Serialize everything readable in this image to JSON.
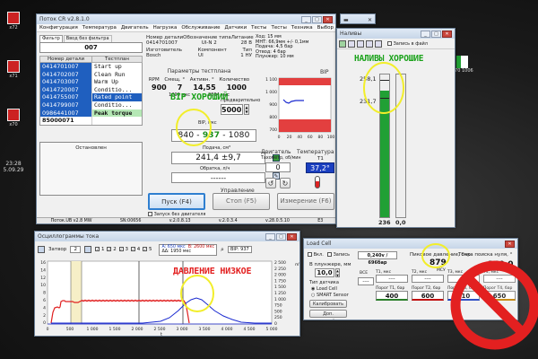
{
  "desktop": {
    "icons": [
      {
        "label": "x72"
      },
      {
        "label": "x71"
      },
      {
        "label": "x70"
      }
    ],
    "clock": [
      "23:28",
      "5.09.29"
    ],
    "right_file": "1.70 1006",
    "accent": "#21a035"
  },
  "main_window": {
    "title": "Поток CR v2.8.1.0",
    "menu": [
      "Конфигурация",
      "Температура",
      "Двигатель",
      "Нагрузка",
      "Обслуживание",
      "Датчики",
      "Тесты",
      "Тесты",
      "Техника",
      "Выбор режима",
      "Тест",
      "Язык",
      "Справка"
    ],
    "tabs": [
      "Фильтр",
      "Ввод без фильтра"
    ],
    "filter_value": "007",
    "list_headers": [
      "Номер детали",
      "Тестплан"
    ],
    "parts": [
      {
        "num": "0414701007",
        "plan": "Start up",
        "hl": true
      },
      {
        "num": "0414702007",
        "plan": "Clean Run",
        "hl": true
      },
      {
        "num": "0414703007",
        "plan": "Warm Up",
        "hl": true
      },
      {
        "num": "0414720007",
        "plan": "Conditio...",
        "hl": true
      },
      {
        "num": "0414755007",
        "plan": "Rated point",
        "hl": true,
        "sel": true
      },
      {
        "num": "0414799007",
        "plan": "Conditio...",
        "hl": true
      },
      {
        "num": "0986441007",
        "plan": "Peak torque",
        "hl": true,
        "peak": true
      },
      {
        "num": "85000071",
        "plan": "",
        "hl": false
      }
    ],
    "stopped_label": "Остановлен",
    "info_headers": [
      "Номер детали",
      "Обозначение типа",
      "Литание"
    ],
    "info_values": [
      "0414701007",
      "UI-N 2",
      "28 В"
    ],
    "info2_headers": [
      "Изготовитель",
      "Компонент",
      "Тип"
    ],
    "info2_values": [
      "Bosch",
      "UI",
      "1 НУ"
    ],
    "info_right": [
      "Ход: 15 мм",
      "МНТ: 66,9мм +/- 0,1мм",
      "Подача: 4,5 бар",
      "Отвод: 4 бар",
      "Плунжер: 10 мм"
    ],
    "params_title": "Параметры тестплана",
    "param_headers": [
      "RPM",
      "Смещ. °",
      "Активн. °",
      "Количество"
    ],
    "param_values": [
      "900",
      "7",
      "14,55",
      "1000"
    ],
    "param_sub": [
      "1296 мкс",
      "2684 мкс"
    ],
    "preset_label": "Предварительно",
    "preset_value": "5000",
    "bip_label": "BIP, мкс",
    "bip_min": "840",
    "bip_val": "937",
    "bip_max": "1080",
    "flow_label": "Подача, см³",
    "flow_value": "241,4 ±9,7",
    "rev_label": "Обратка, л/ч",
    "rev_value": "------",
    "bip_chart_title": "BIP",
    "bip_y_ticks": [
      "1 100",
      "1 000",
      "900",
      "800",
      "700"
    ],
    "bip_x_ticks": [
      "0",
      "20",
      "40",
      "60",
      "80",
      "100"
    ],
    "engine_label": "Двигатель",
    "temp_label": "Температура",
    "tacho_label": "Тахометр, об/мин",
    "tacho_value": "0",
    "t1_label": "T1",
    "t1_value": "37,2°",
    "control_label": "Управление",
    "start_button": "Пуск (F4)",
    "stop_button": "Стоп (F5)",
    "measure_button": "Измерение (F6)",
    "no_engine_check": "Запуск без двигателя",
    "status": [
      "Поток.UB v2.8 MW",
      "SN:00656",
      "v.2.0.8.13",
      "v.2.0.3.4",
      "v.28.0.5.10",
      "E3"
    ]
  },
  "fill_window": {
    "title": "Наливы",
    "check_label": "Запись в файл",
    "val_top": "258,1",
    "val_mid": "231,7",
    "bottom_value": "236",
    "bottom_value2": "0,0",
    "fill_level": 0.885
  },
  "osc_window": {
    "title": "Осциллограммы тока",
    "gate_label": "Затвор",
    "gate_value": "2",
    "chan_labels": [
      "1",
      "2",
      "3",
      "4",
      "5"
    ],
    "box1": [
      "A: 650 мкс",
      "B: 2600 мкс",
      "ΔΔ: 1950 мкс"
    ],
    "bip_box": "BIP: 937",
    "x_ticks": [
      "0",
      "500",
      "1 000",
      "1 500",
      "2 000",
      "2 500",
      "3 000",
      "3 500",
      "4 000",
      "4 500",
      "5 000"
    ],
    "y_left": [
      "16",
      "14",
      "12",
      "10",
      "8",
      "6",
      "4",
      "2",
      "0"
    ],
    "y_right": [
      "2 500",
      "2 250",
      "2 000",
      "1 750",
      "1 500",
      "1 250",
      "1 000",
      "750",
      "500",
      "250",
      "0"
    ],
    "y_right_unit": "mV",
    "t_label": "t"
  },
  "load_window": {
    "title": "Load Cell",
    "checks": [
      "Вкл.",
      "Запись"
    ],
    "range_label": "0,240v / 696бар",
    "point_label": "Точка поиска нуля, °",
    "point_value": "340,0",
    "plunger_label": "В плунжере, мм",
    "plunger_value": "10,0",
    "peak_label": "Пиковое давление, бар",
    "peak_value": "879",
    "nbar_label": "МСУ",
    "sensor_title": "Тип датчика",
    "sensor_options": [
      "Load Cell",
      "SMART Sensor"
    ],
    "calibrate_button": "Калибровать",
    "settings_button": "Доп. настройки",
    "t_cols": [
      {
        "label": "T1, мкс",
        "val": "----",
        "thr_label": "Порог T1, бар",
        "thr": "400",
        "color": "#2a7f2a"
      },
      {
        "label": "T2, мкс",
        "val": "----",
        "thr_label": "Порог T2, бар",
        "thr": "600",
        "color": "#c01010"
      },
      {
        "label": "T3, мкс",
        "val": "----",
        "thr_label": "Порог T3, бар",
        "thr": "610",
        "color": "#1a3fc0"
      },
      {
        "label": "T4, мкс",
        "val": "----",
        "thr_label": "Порог T4, бар",
        "thr": "650",
        "color": "#c08000"
      }
    ],
    "small_vals": [
      "ВСЕ",
      "----"
    ]
  },
  "annotations": {
    "bip_good": "BIP ХОРОШИЙ",
    "fill_good": "НАЛИВЫ ХОРОШИЕ",
    "pressure_low": "ДАВЛЕНИЕ НИЗКОЕ",
    "red": "#e32020",
    "green": "#1aa21a",
    "yellow": "#f2ee2a"
  }
}
